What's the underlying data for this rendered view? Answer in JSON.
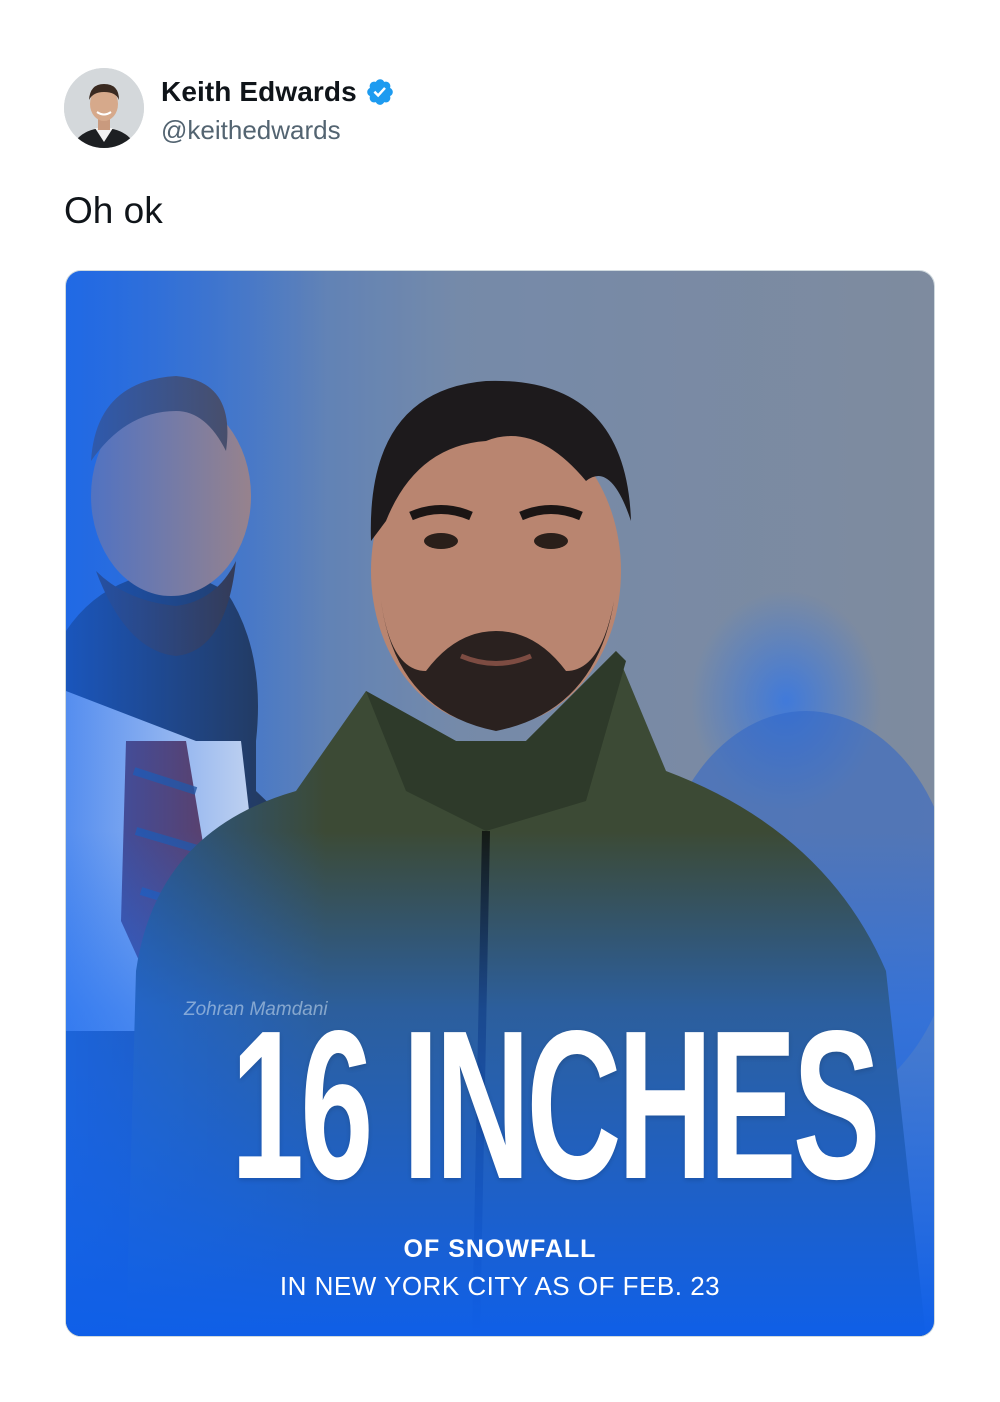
{
  "tweet": {
    "author": {
      "display_name": "Keith Edwards",
      "handle": "@keithedwards",
      "verified": true,
      "avatar_icon": "person-avatar"
    },
    "text": "Oh ok",
    "media": {
      "headline": "16 INCHES",
      "line_1": "OF SNOWFALL",
      "line_2": "IN NEW YORK CITY AS OF FEB. 23",
      "jacket_text": "Zohran Mamdani"
    }
  },
  "colors": {
    "verified_badge": "#1d9bf0",
    "text_primary": "#0f1419",
    "text_secondary": "#536471",
    "media_blue": "#1a6fe0"
  }
}
